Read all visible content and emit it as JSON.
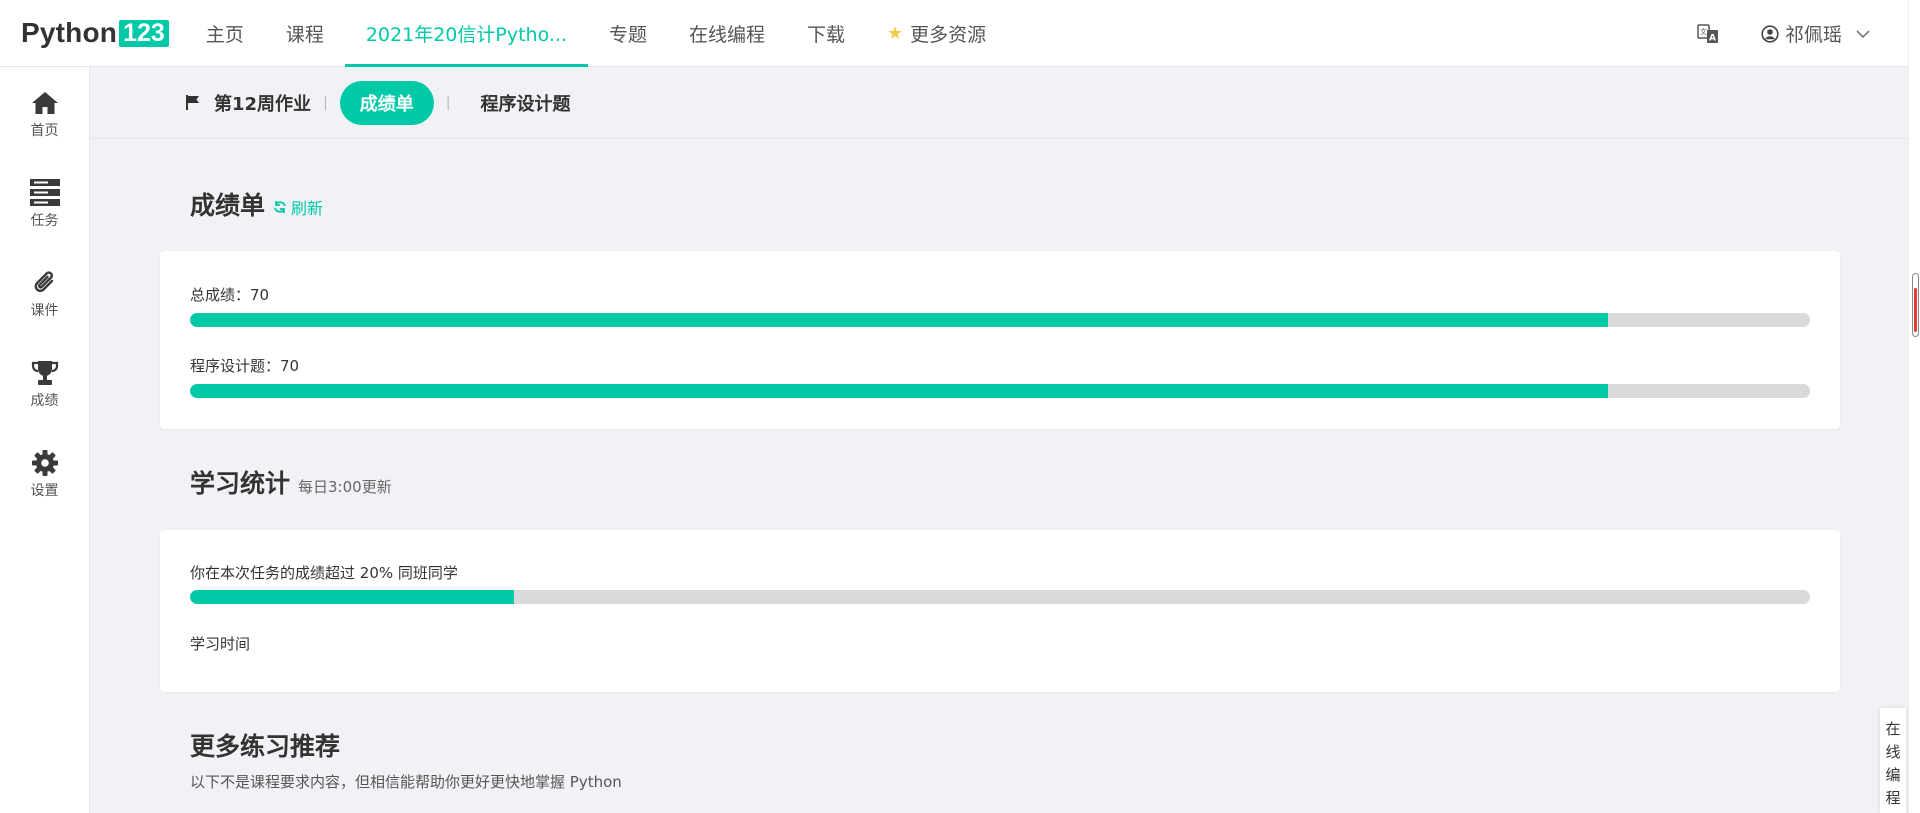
{
  "brand": {
    "name": "Python",
    "number": "123",
    "accent": "#00c9a7"
  },
  "nav": {
    "items": [
      "主页",
      "课程",
      "2021年20信计Pytho...",
      "专题",
      "在线编程",
      "下载"
    ],
    "more_resources": "更多资源"
  },
  "user": {
    "name": "祁佩瑶"
  },
  "sidebar": {
    "items": [
      "首页",
      "任务",
      "课件",
      "成绩",
      "设置"
    ]
  },
  "subnav": {
    "assignment": "第12周作业",
    "active_tab": "成绩单",
    "program_tab": "程序设计题"
  },
  "grades": {
    "title": "成绩单",
    "refresh_label": "刷新",
    "total_label": "总成绩：",
    "total_value": "70",
    "total_fill": 0.875,
    "program_label": "程序设计题：",
    "program_value": "70",
    "program_fill": 0.875
  },
  "stats": {
    "title": "学习统计",
    "update_note": "每日3:00更新",
    "exceed_text": "你在本次任务的成绩超过 20% 同班同学",
    "exceed_fill": 0.2,
    "study_time_label": "学习时间"
  },
  "more": {
    "title": "更多练习推荐",
    "subtitle": "以下不是课程要求内容，但相信能帮助你更好更快地掌握 Python"
  },
  "float_button": {
    "chars": [
      "在",
      "线",
      "编",
      "程"
    ]
  }
}
